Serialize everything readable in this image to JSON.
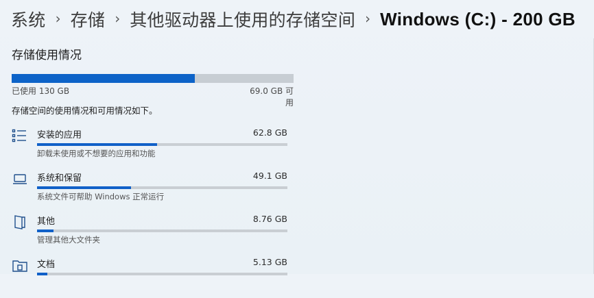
{
  "breadcrumb": {
    "items": [
      "系统",
      "存储",
      "其他驱动器上使用的存储空间"
    ],
    "current": "Windows (C:) - 200 GB",
    "separator": "›"
  },
  "storage": {
    "title": "存储使用情况",
    "used_label": "已使用 130 GB",
    "free_label": "69.0 GB 可用",
    "used_fraction": 0.65,
    "description": "存储空间的使用情况和可用情况如下。"
  },
  "categories": [
    {
      "name": "安装的应用",
      "size": "62.8 GB",
      "sub": "卸载未使用或不想要的应用和功能",
      "fraction": 0.48,
      "icon": "apps-list-icon"
    },
    {
      "name": "系统和保留",
      "size": "49.1 GB",
      "sub": "系统文件可帮助 Windows 正常运行",
      "fraction": 0.375,
      "icon": "laptop-icon"
    },
    {
      "name": "其他",
      "size": "8.76 GB",
      "sub": "管理其他大文件夹",
      "fraction": 0.065,
      "icon": "folder-icon"
    },
    {
      "name": "文档",
      "size": "5.13 GB",
      "sub": "",
      "fraction": 0.04,
      "icon": "document-folder-icon"
    }
  ],
  "colors": {
    "accent": "#0d63c8",
    "track": "#c7cdd3"
  }
}
